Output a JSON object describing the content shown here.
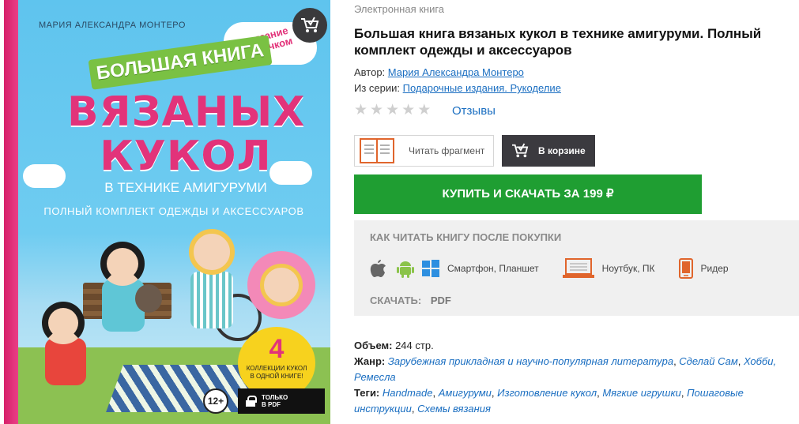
{
  "cover": {
    "author": "МАРИЯ АЛЕКСАНДРА МОНТЕРО",
    "crochet_line1": "вязание",
    "crochet_line2": "крючком",
    "banner": "БОЛЬШАЯ КНИГА",
    "title_line1": "ВЯЗАНЫХ",
    "title_line2": "КУКОЛ",
    "subtitle1": "В ТЕХНИКЕ АМИГУРУМИ",
    "subtitle2": "ПОЛНЫЙ КОМПЛЕКТ ОДЕЖДЫ И АКСЕССУАРОВ",
    "badge_number": "4",
    "badge_text": "КОЛЛЕКЦИИ КУКОЛ В ОДНОЙ КНИГЕ!",
    "age_rating": "12+",
    "pdf_badge_line1": "ТОЛЬКО",
    "pdf_badge_line2": "В PDF"
  },
  "info": {
    "doc_type": "Электронная книга",
    "title": "Большая книга вязаных кукол в технике амигуруми. Полный комплект одежды и аксессуаров",
    "author_label": "Автор:",
    "author_name": "Мария Александра Монтеро",
    "series_label": "Из серии:",
    "series_name": "Подарочные издания. Рукоделие",
    "rating": 0,
    "reviews_label": "Отзывы",
    "read_fragment_label": "Читать фрагмент",
    "in_cart_label": "В корзине",
    "buy_label": "КУПИТЬ И СКАЧАТЬ ЗА 199 ₽"
  },
  "howto": {
    "title": "КАК ЧИТАТЬ КНИГУ ПОСЛЕ ПОКУПКИ",
    "smartphone_label": "Смартфон, Планшет",
    "laptop_label": "Ноутбук, ПК",
    "reader_label": "Ридер",
    "download_label": "СКАЧАТЬ:",
    "download_format": "PDF"
  },
  "details": {
    "volume_label": "Объем:",
    "volume_value": "244 стр.",
    "genre_label": "Жанр:",
    "genres": [
      "Зарубежная прикладная и научно-популярная литература",
      "Сделай Сам",
      "Хобби, Ремесла"
    ],
    "tags_label": "Теги:",
    "tags": [
      "Handmade",
      "Амигуруми",
      "Изготовление кукол",
      "Мягкие игрушки",
      "Пошаговые инструкции",
      "Схемы вязания"
    ]
  },
  "colors": {
    "buy_green": "#1f9e32",
    "cart_dark": "#3b3a3f",
    "link_blue": "#1a6ec1",
    "cover_pink": "#e2337a"
  }
}
